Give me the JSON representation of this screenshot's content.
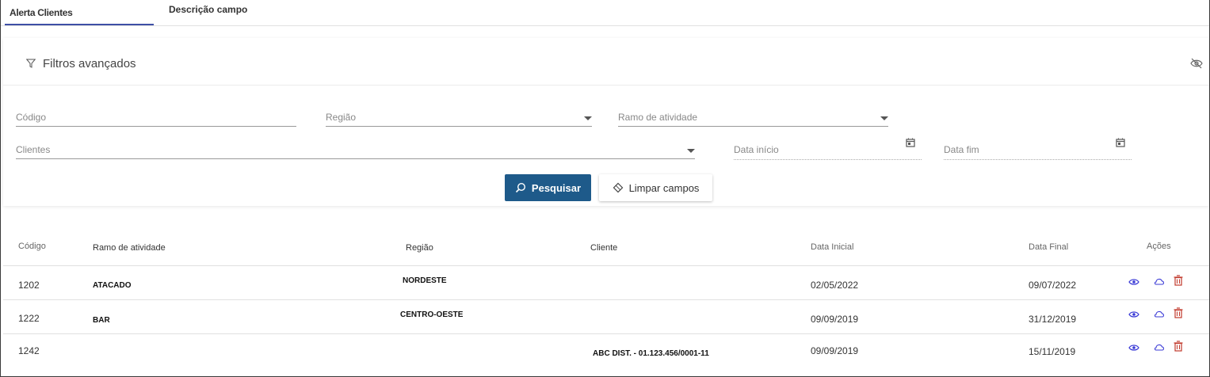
{
  "tabs": [
    {
      "label": "Alerta Clientes",
      "active": true
    },
    {
      "label": "Descrição campo",
      "active": false
    }
  ],
  "filters": {
    "title": "Filtros avançados",
    "codigo": "Código",
    "regiao": "Região",
    "ramo": "Ramo de atividade",
    "clientes": "Clientes",
    "data_inicio": "Data início",
    "data_fim": "Data fim",
    "search_button": "Pesquisar",
    "clear_button": "Limpar campos"
  },
  "table": {
    "headers": {
      "codigo": "Código",
      "ramo": "Ramo de atividade",
      "regiao": "Região",
      "cliente": "Cliente",
      "data_inicial": "Data Inicial",
      "data_final": "Data Final",
      "acoes": "Ações"
    },
    "rows": [
      {
        "codigo": "1202",
        "ramo": "ATACADO",
        "regiao": "NORDESTE",
        "cliente": "",
        "data_inicial": "02/05/2022",
        "data_final": "09/07/2022"
      },
      {
        "codigo": "1222",
        "ramo": "BAR",
        "regiao": "CENTRO-OESTE",
        "cliente": "",
        "data_inicial": "09/09/2019",
        "data_final": "31/12/2019"
      },
      {
        "codigo": "1242",
        "ramo": "",
        "regiao": "",
        "cliente": "ABC DIST. - 01.123.456/0001-11",
        "data_inicial": "09/09/2019",
        "data_final": "15/11/2019"
      }
    ]
  },
  "colors": {
    "primary": "#1e5a8a",
    "tab_indicator": "#3e4fa6",
    "view_icon": "#3b3bd6",
    "delete_icon": "#c0392b"
  }
}
